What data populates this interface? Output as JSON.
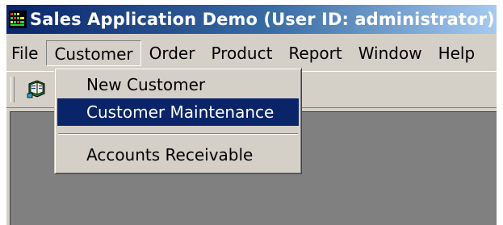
{
  "window": {
    "title": "Sales Application Demo (User ID: administrator)",
    "app_icon": "sales-app-icon"
  },
  "menubar": {
    "items": [
      {
        "label": "File"
      },
      {
        "label": "Customer",
        "active": true
      },
      {
        "label": "Order"
      },
      {
        "label": "Product"
      },
      {
        "label": "Report"
      },
      {
        "label": "Window"
      },
      {
        "label": "Help"
      }
    ]
  },
  "toolbar": {
    "buttons": [
      {
        "icon": "book-icon"
      }
    ]
  },
  "customer_menu": {
    "items": [
      {
        "label": "New Customer",
        "selected": false
      },
      {
        "label": "Customer Maintenance",
        "selected": true
      },
      {
        "separator": true
      },
      {
        "label": "Accounts Receivable",
        "selected": false
      }
    ]
  },
  "colors": {
    "titlebar_start": "#0a246a",
    "titlebar_end": "#a6caf0",
    "face": "#d4d0c8",
    "highlight": "#0a246a",
    "client_area": "#808080"
  }
}
